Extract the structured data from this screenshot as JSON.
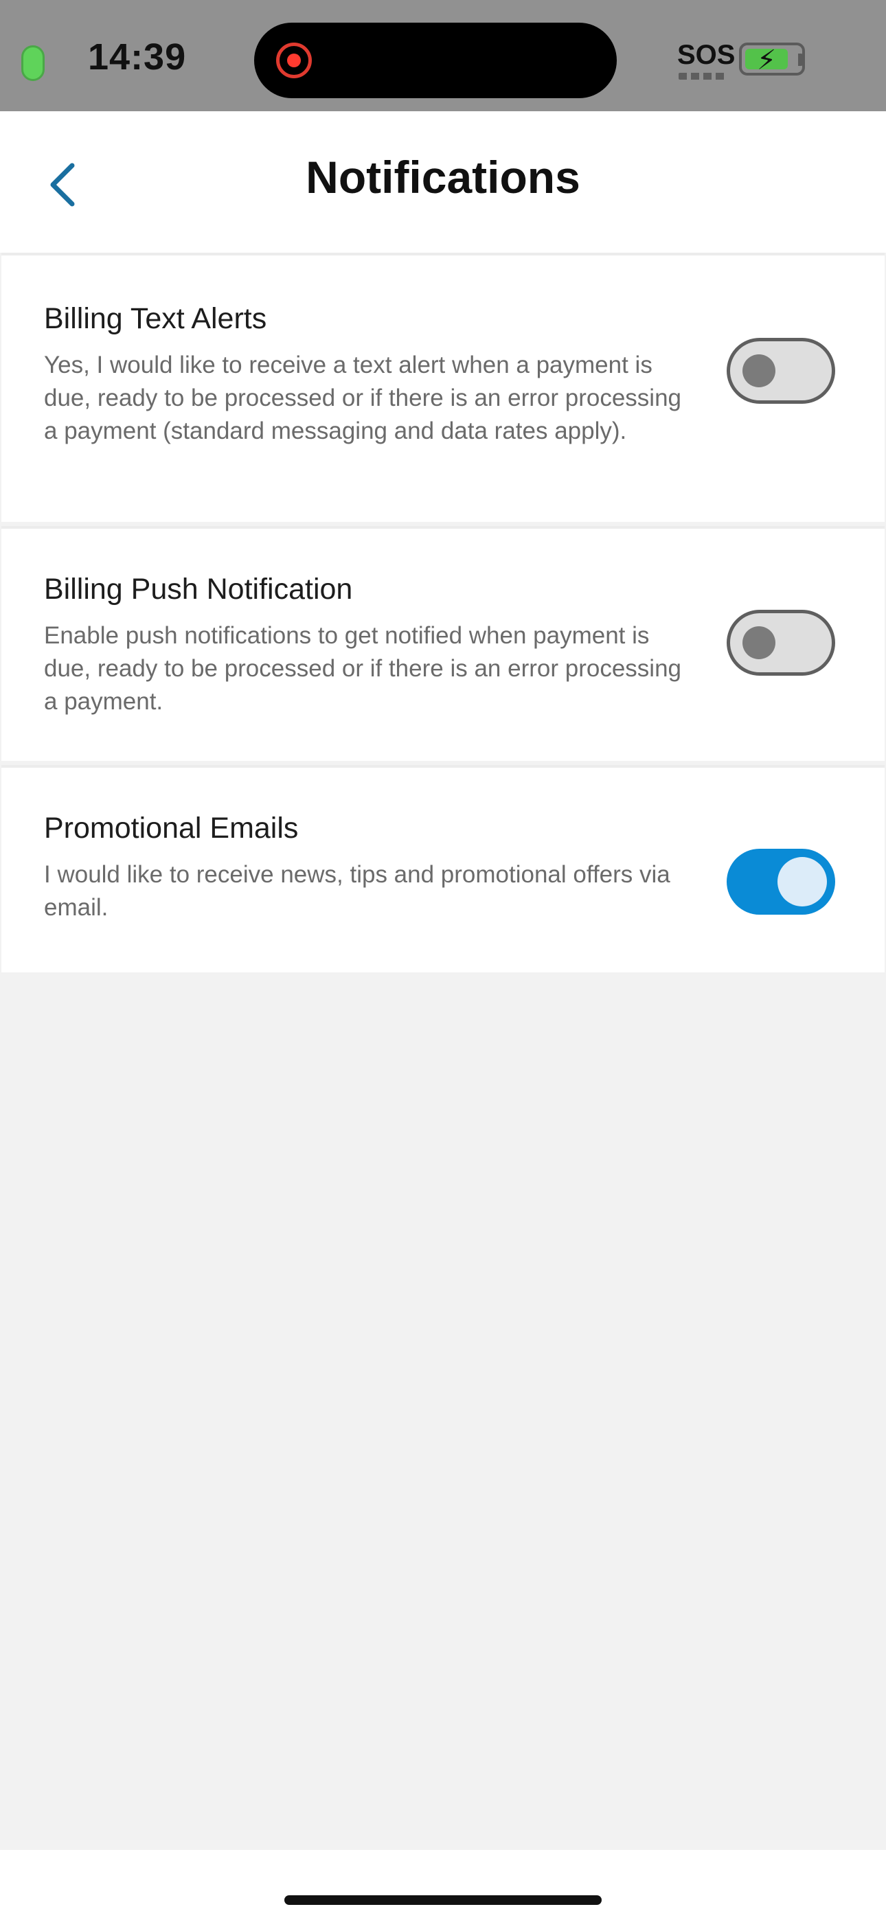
{
  "status_bar": {
    "time": "14:39",
    "sos": "SOS",
    "battery_bolt": "⚡"
  },
  "nav": {
    "title": "Notifications",
    "back_icon": "chevron-left-icon"
  },
  "colors": {
    "accent": "#0a8bd6",
    "back_chevron": "#1a6fa0",
    "background": "#f2f2f2"
  },
  "settings": [
    {
      "title": "Billing Text Alerts",
      "description": "Yes, I would like to receive a text alert when a payment is due, ready to be processed or if there is an error processing a payment (standard messaging and data rates apply).",
      "enabled": false
    },
    {
      "title": "Billing Push Notification",
      "description": "Enable push notifications to get notified when payment is due, ready to be processed or if there is an error processing a payment.",
      "enabled": false
    },
    {
      "title": "Promotional Emails",
      "description": "I would like to receive news, tips and promotional offers via email.",
      "enabled": true
    }
  ]
}
